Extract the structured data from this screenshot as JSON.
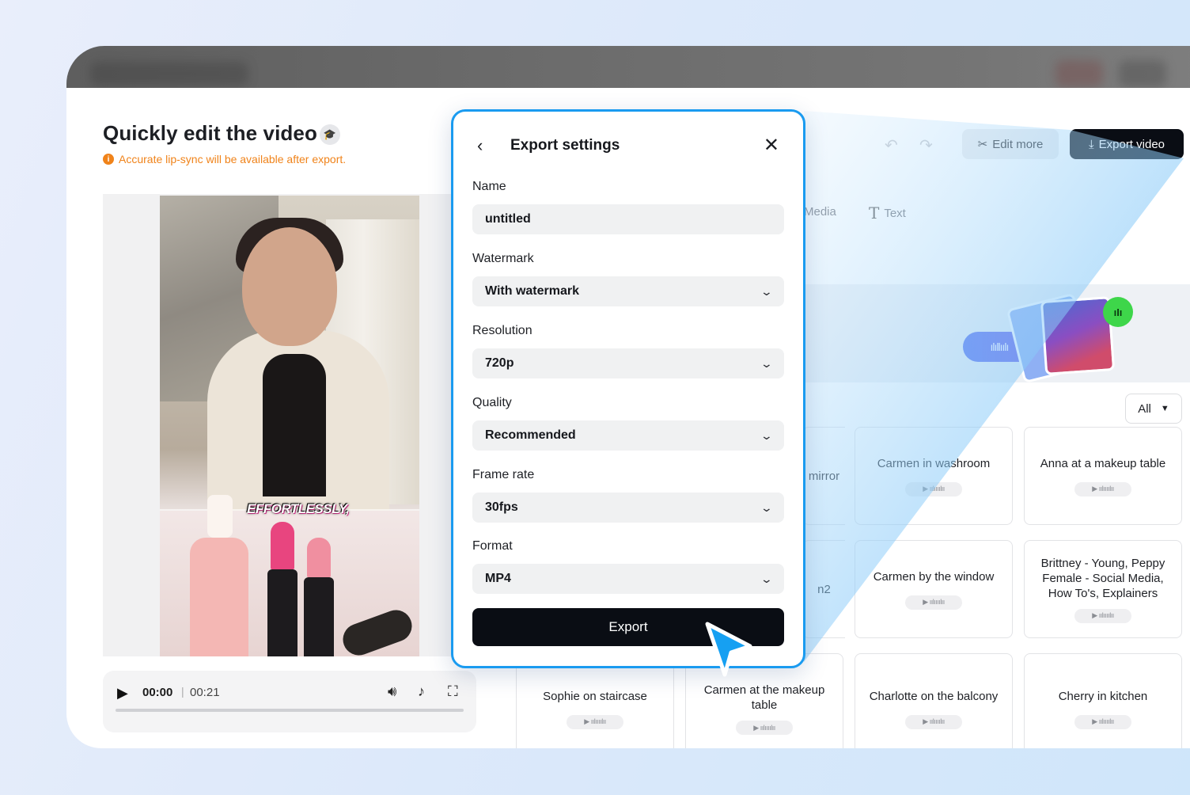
{
  "editor": {
    "title": "Quickly edit the video",
    "warning": "Accurate lip-sync will be available after export.",
    "video_caption": "EFFORTLESSLY,"
  },
  "player": {
    "current_time": "00:00",
    "separator": "|",
    "duration": "00:21",
    "progress": 0
  },
  "toolbar": {
    "edit_more_label": "Edit more",
    "export_video_label": "Export video"
  },
  "tabs": {
    "media_partial": "Media",
    "text": "Text"
  },
  "filter": {
    "selected": "All"
  },
  "avatars": [
    {
      "label": "mirror"
    },
    {
      "label": "Carmen in washroom"
    },
    {
      "label": "Anna at a makeup table"
    },
    {
      "label": "n2"
    },
    {
      "label": "Carmen by the window"
    },
    {
      "label": "Brittney - Young, Peppy Female - Social Media, How To's, Explainers"
    },
    {
      "label": "Sophie on staircase"
    },
    {
      "label": "Carmen at the makeup table"
    },
    {
      "label": "Charlotte on the balcony"
    },
    {
      "label": "Cherry in kitchen"
    }
  ],
  "export_dialog": {
    "title": "Export settings",
    "name_label": "Name",
    "name_value": "untitled",
    "watermark_label": "Watermark",
    "watermark_value": "With watermark",
    "resolution_label": "Resolution",
    "resolution_value": "720p",
    "quality_label": "Quality",
    "quality_value": "Recommended",
    "frame_rate_label": "Frame rate",
    "frame_rate_value": "30fps",
    "format_label": "Format",
    "format_value": "MP4",
    "export_label": "Export"
  },
  "colors": {
    "accent_border": "#1a9bf0",
    "warning": "#f0831a",
    "primary_button": "#0a0d14",
    "beam": "#4fb3f6",
    "mic_badge": "#3ed64a"
  },
  "icons": {
    "back": "chevron-left-icon",
    "close": "close-icon",
    "undo": "undo-icon",
    "redo": "redo-icon",
    "edit_more": "scissors-icon",
    "export_video": "download-icon",
    "play": "play-icon",
    "volume": "volume-icon",
    "tiktok": "tiktok-icon",
    "fullscreen": "fullscreen-icon",
    "pointer": "pointer-cursor-icon"
  }
}
